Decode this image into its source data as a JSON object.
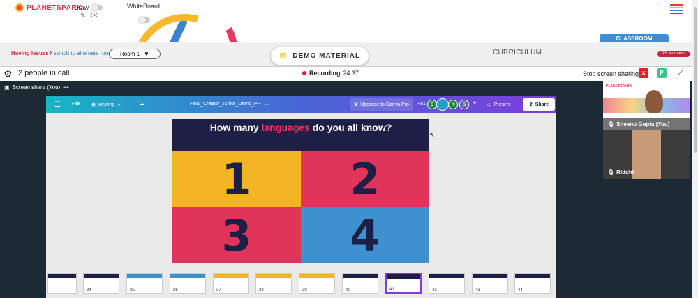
{
  "brand": {
    "name": "PLANETSPARK"
  },
  "toolbar": {
    "draw_label": "Draw",
    "whiteboard_label": "WhiteBoard"
  },
  "nav": {
    "issues_text": "Having issues?",
    "switch_text": "switch to alternate room",
    "room_select": "Room 1",
    "demo_material": "DEMO MATERIAL",
    "curriculum": "CURRICULUM",
    "classroom": "CLASSROOM",
    "ps_moments": "PS Moments"
  },
  "call": {
    "people": "2 people in call",
    "recording_label": "Recording",
    "recording_time": "24:37",
    "stop_sharing": "Stop screen sharing",
    "p_badge": "P"
  },
  "screenshare": {
    "label": "Screen share (You)",
    "more": "•••"
  },
  "canva": {
    "file": "File",
    "viewing": "Viewing",
    "doc_title": "Final_Creator_Junior_Demo_PPT ...",
    "upgrade": "Upgrade to Canva Pro",
    "extra_count": "+81",
    "avatars": [
      "S",
      "K",
      "S"
    ],
    "present": "Present",
    "share": "Share"
  },
  "slide": {
    "title_pre": "How many ",
    "title_hl": "languages",
    "title_post": " do you all know?",
    "cells": [
      "1",
      "2",
      "3",
      "4"
    ]
  },
  "thumbnails": [
    "34",
    "35",
    "36",
    "37",
    "38",
    "39",
    "40",
    "41",
    "42",
    "43",
    "44"
  ],
  "participants": [
    {
      "name": "Sheenu Gupta (You)"
    },
    {
      "name": "Riddhi"
    }
  ],
  "colors": {
    "brand_red": "#e8344e",
    "accent_blue": "#3a8fd6",
    "slide_navy": "#1e1f47",
    "slide_yellow": "#f3b523",
    "slide_pink": "#e0345a",
    "slide_blue": "#3e91cf"
  }
}
